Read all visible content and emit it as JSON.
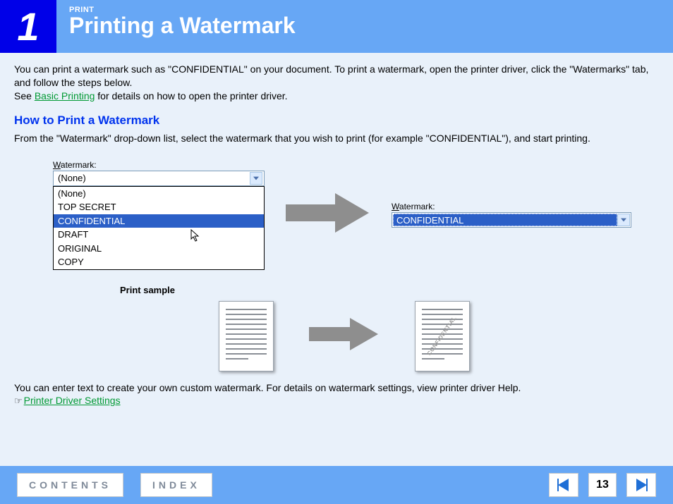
{
  "header": {
    "chapter_num": "1",
    "category": "PRINT",
    "title": "Printing a Watermark"
  },
  "intro": {
    "p1a": "You can print a watermark such as \"CONFIDENTIAL\" on your document. To print a watermark, open the printer driver, click the \"Watermarks\" tab, and follow the steps below.",
    "p1b_prefix": "See ",
    "p1b_link": "Basic Printing",
    "p1b_suffix": " for details on how to open the printer driver."
  },
  "section": {
    "title": "How to Print a Watermark",
    "lead": "From the \"Watermark\" drop-down list, select the watermark that you wish to print (for example \"CONFIDENTIAL\"), and start printing."
  },
  "dropdown": {
    "label_char": "W",
    "label_rest": "atermark:",
    "selected": "(None)",
    "options": [
      "(None)",
      "TOP SECRET",
      "CONFIDENTIAL",
      "DRAFT",
      "ORIGINAL",
      "COPY"
    ],
    "highlighted": "CONFIDENTIAL"
  },
  "dropdown2": {
    "label_char": "W",
    "label_rest": "atermark:",
    "value": "CONFIDENTIAL"
  },
  "sample": {
    "label": "Print sample",
    "watermark_text": "CONFIDENTIAL"
  },
  "custom": {
    "text": "You can enter text to create your own custom watermark. For details on watermark settings, view printer driver Help.",
    "hand": "☞",
    "link": "Printer Driver Settings"
  },
  "footer": {
    "contents": "CONTENTS",
    "index": "INDEX",
    "page": "13"
  }
}
